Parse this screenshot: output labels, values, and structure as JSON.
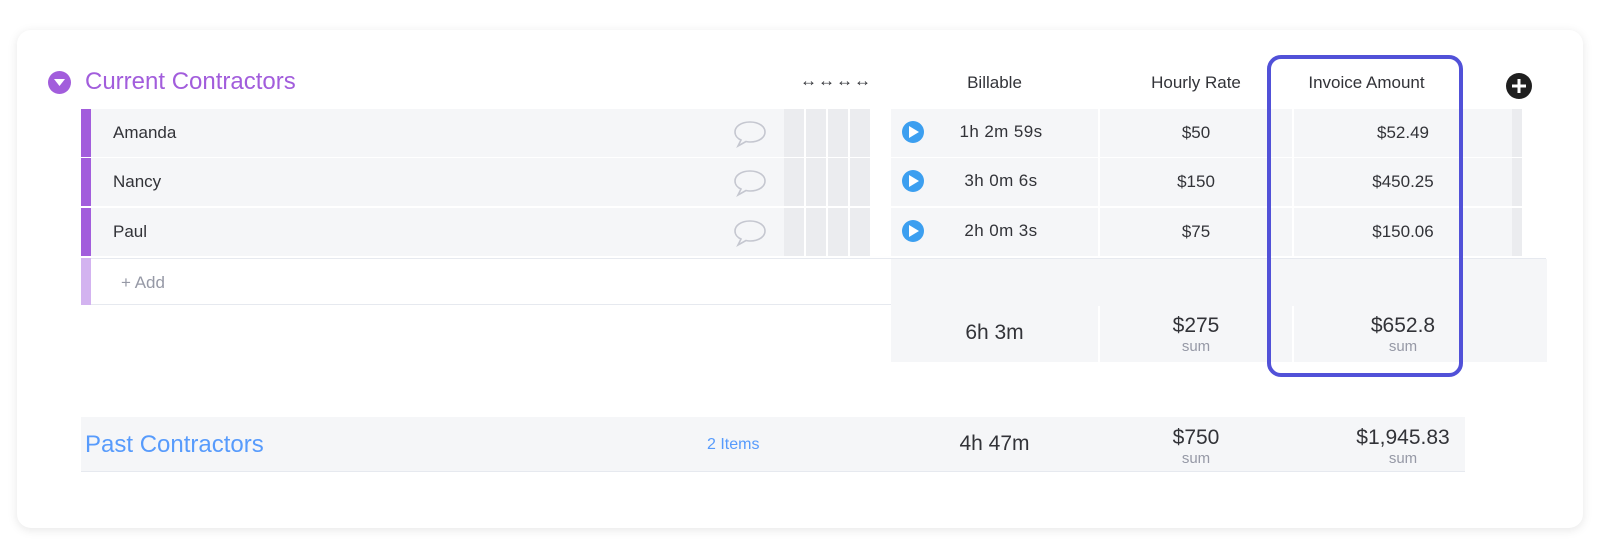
{
  "current_group": {
    "title": "Current Contractors",
    "color": "#a25ddc",
    "resize_arrows": "↔↔↔↔",
    "columns": {
      "billable": "Billable",
      "hourly_rate": "Hourly Rate",
      "invoice_amount": "Invoice Amount"
    },
    "rows": [
      {
        "name": "Amanda",
        "billable": "1h 2m 59s",
        "hourly_rate": "$50",
        "invoice_amount": "$52.49"
      },
      {
        "name": "Nancy",
        "billable": "3h 0m 6s",
        "hourly_rate": "$150",
        "invoice_amount": "$450.25"
      },
      {
        "name": "Paul",
        "billable": "2h 0m 3s",
        "hourly_rate": "$75",
        "invoice_amount": "$150.06"
      }
    ],
    "add_label": "+ Add",
    "summary": {
      "billable": "6h 3m",
      "hourly_rate": "$275",
      "hourly_rate_label": "sum",
      "invoice_amount": "$652.8",
      "invoice_amount_label": "sum"
    }
  },
  "past_group": {
    "title": "Past Contractors",
    "color": "#579bfc",
    "items_count": "2 Items",
    "billable": "4h 47m",
    "hourly_rate": "$750",
    "hourly_rate_label": "sum",
    "invoice_amount": "$1,945.83",
    "invoice_amount_label": "sum"
  },
  "highlight_color": "#5151d8",
  "icons": [
    "chevron-down-icon",
    "add-column-icon",
    "chat-bubble-icon",
    "play-icon"
  ]
}
